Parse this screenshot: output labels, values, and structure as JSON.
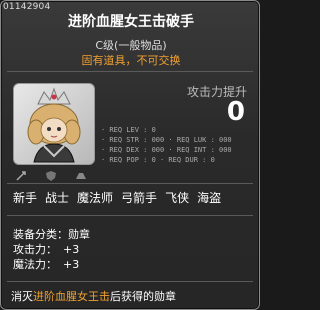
{
  "item_id": "01142904",
  "title": "进阶血腥女王击破手",
  "grade": "C级(一般物品)",
  "tag": "固有道具，不可交换",
  "attack_label": "攻击力提升",
  "attack_value": "0",
  "requirements": [
    "· REQ LEV    :   0",
    "· REQ STR  :  000   · REQ LUK  :  000",
    "· REQ DEX  :  000   · REQ INT  :  000",
    "· REQ POP  :   0    · REQ DUR  :   0"
  ],
  "jobs": [
    "新手",
    "战士",
    "魔法师",
    "弓箭手",
    "飞侠",
    "海盗"
  ],
  "stats": {
    "category_label": "装备分类：",
    "category_value": "勋章",
    "attack_label": "攻击力：",
    "attack_value": "+3",
    "magic_label": "魔法力：",
    "magic_value": "+3"
  },
  "description": {
    "prefix": "消灭",
    "highlight": "进阶血腥女王击",
    "suffix": "后获得的勋章"
  },
  "colors": {
    "accent": "#f0a030",
    "background": "#2a2a2a"
  },
  "icons": [
    "bloody-queen-icon"
  ]
}
